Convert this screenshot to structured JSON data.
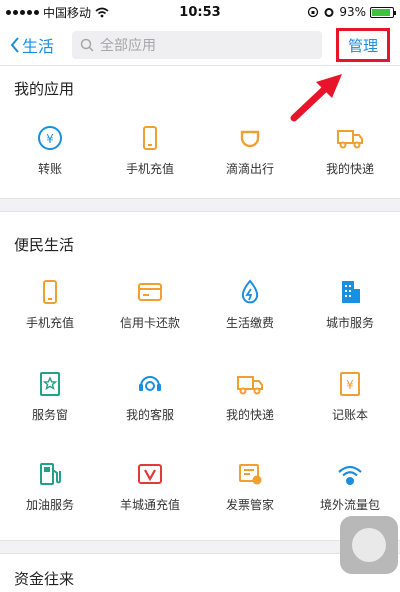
{
  "status_bar": {
    "carrier": "中国移动",
    "time": "10:53",
    "battery": "93%"
  },
  "nav": {
    "back_label": "生活",
    "search_placeholder": "全部应用",
    "manage_label": "管理"
  },
  "accent_color": "#1a8fe0",
  "sections": [
    {
      "title": "我的应用",
      "apps": [
        {
          "label": "转账",
          "icon": "transfer-icon"
        },
        {
          "label": "手机充值",
          "icon": "phone-icon"
        },
        {
          "label": "滴滴出行",
          "icon": "didi-icon"
        },
        {
          "label": "我的快递",
          "icon": "truck-icon"
        }
      ]
    },
    {
      "title": "便民生活",
      "apps": [
        {
          "label": "手机充值",
          "icon": "phone-icon"
        },
        {
          "label": "信用卡还款",
          "icon": "credit-card-icon"
        },
        {
          "label": "生活缴费",
          "icon": "water-drop-icon"
        },
        {
          "label": "城市服务",
          "icon": "building-icon"
        },
        {
          "label": "服务窗",
          "icon": "service-window-icon"
        },
        {
          "label": "我的客服",
          "icon": "headset-icon"
        },
        {
          "label": "我的快递",
          "icon": "truck-icon"
        },
        {
          "label": "记账本",
          "icon": "ledger-icon"
        },
        {
          "label": "加油服务",
          "icon": "fuel-icon"
        },
        {
          "label": "羊城通充值",
          "icon": "yct-card-icon"
        },
        {
          "label": "发票管家",
          "icon": "invoice-icon"
        },
        {
          "label": "境外流量包",
          "icon": "wifi-globe-icon"
        }
      ]
    },
    {
      "title": "资金往来",
      "apps": []
    }
  ]
}
